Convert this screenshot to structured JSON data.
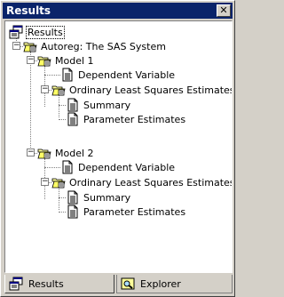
{
  "window": {
    "title": "Results"
  },
  "tree": {
    "root": "Results",
    "autoreg": "Autoreg:  The SAS System",
    "model1": {
      "label": "Model 1",
      "dependent": "Dependent Variable",
      "ols": "Ordinary Least Squares Estimates",
      "summary": "Summary",
      "params": "Parameter Estimates"
    },
    "model2": {
      "label": "Model 2",
      "dependent": "Dependent Variable",
      "ols": "Ordinary Least Squares Estimates",
      "summary": "Summary",
      "params": "Parameter Estimates"
    }
  },
  "tabs": {
    "results": "Results",
    "explorer": "Explorer"
  },
  "icons": {
    "results": "results-window-icon",
    "folder": "open-folder-icon",
    "doc": "output-document-icon",
    "explorer": "magnifier-icon"
  }
}
